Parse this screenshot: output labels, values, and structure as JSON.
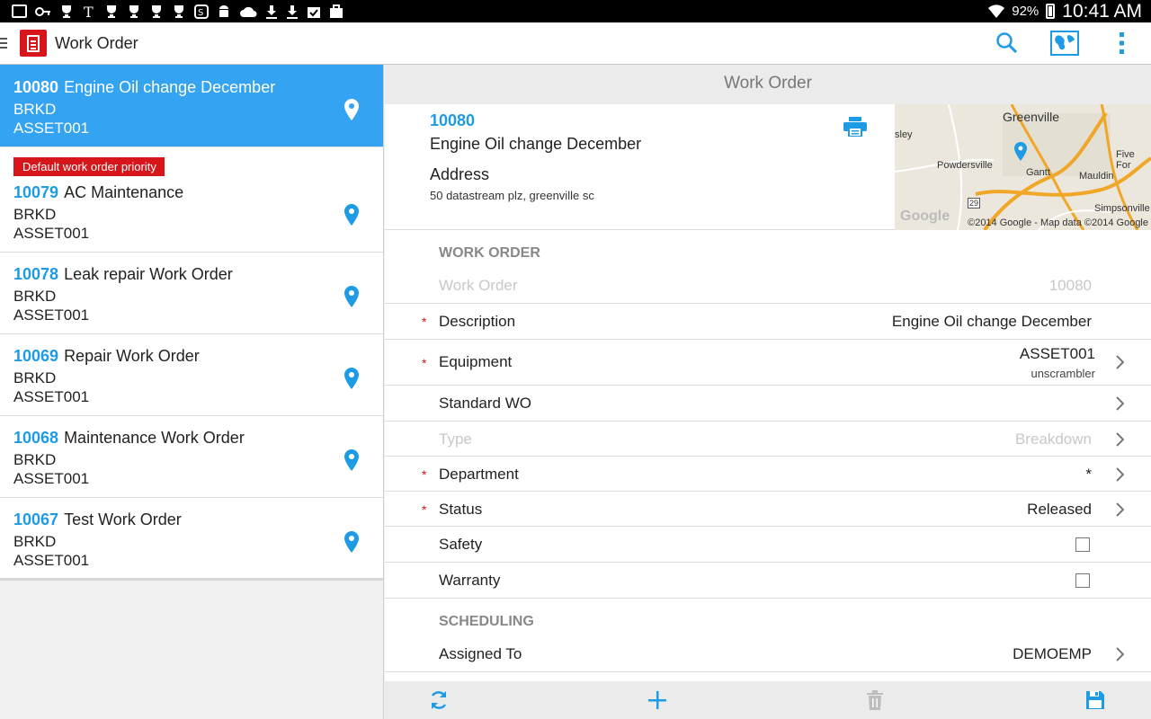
{
  "status_bar": {
    "battery": "92%",
    "time": "10:41 AM",
    "notification_icons": [
      "gallery-icon",
      "key-icon",
      "trophy-icon",
      "news-icon",
      "trophy-icon",
      "trophy-icon",
      "trophy-icon",
      "trophy-icon",
      "skype-icon",
      "android-icon",
      "cloud-download-icon",
      "download-icon",
      "download-icon",
      "check-icon",
      "briefcase-icon"
    ]
  },
  "action_bar": {
    "title": "Work Order"
  },
  "work_orders": [
    {
      "number": "10080",
      "title": "Engine Oil change December",
      "dept": "BRKD",
      "asset": "ASSET001",
      "badge": "",
      "selected": true
    },
    {
      "number": "10079",
      "title": "AC Maintenance",
      "dept": "BRKD",
      "asset": "ASSET001",
      "badge": "Default work order priority",
      "selected": false
    },
    {
      "number": "10078",
      "title": "Leak repair Work Order",
      "dept": "BRKD",
      "asset": "ASSET001",
      "badge": "",
      "selected": false
    },
    {
      "number": "10069",
      "title": "Repair Work Order",
      "dept": "BRKD",
      "asset": "ASSET001",
      "badge": "",
      "selected": false
    },
    {
      "number": "10068",
      "title": "Maintenance Work Order",
      "dept": "BRKD",
      "asset": "ASSET001",
      "badge": "",
      "selected": false
    },
    {
      "number": "10067",
      "title": "Test Work Order",
      "dept": "BRKD",
      "asset": "ASSET001",
      "badge": "",
      "selected": false
    }
  ],
  "detail": {
    "header": "Work Order",
    "summary": {
      "number": "10080",
      "description": "Engine Oil change December",
      "address_label": "Address",
      "address": "50 datastream plz, greenville sc"
    },
    "map": {
      "labels": [
        "Greenville",
        "sley",
        "Powdersville",
        "Gantt",
        "Mauldin",
        "Five For",
        "Simpsonville",
        "29"
      ],
      "google": "Google",
      "copyright": "©2014 Google - Map data ©2014 Google"
    },
    "section_work_order": "WORK ORDER",
    "section_scheduling": "SCHEDULING",
    "fields": {
      "work_order": {
        "label": "Work Order",
        "value": "10080"
      },
      "description": {
        "label": "Description",
        "value": "Engine Oil change December"
      },
      "equipment": {
        "label": "Equipment",
        "value": "ASSET001",
        "sub": "unscrambler"
      },
      "standard_wo": {
        "label": "Standard WO",
        "value": ""
      },
      "type": {
        "label": "Type",
        "value": "Breakdown"
      },
      "department": {
        "label": "Department",
        "value": "*"
      },
      "status": {
        "label": "Status",
        "value": "Released"
      },
      "safety": {
        "label": "Safety",
        "checked": false
      },
      "warranty": {
        "label": "Warranty",
        "checked": false
      },
      "assigned_to": {
        "label": "Assigned To",
        "value": "DEMOEMP"
      }
    },
    "required_marker": "*"
  },
  "colors": {
    "accent": "#1e9be5",
    "selected_row": "#33a3f2",
    "brand_red": "#d7161c"
  }
}
